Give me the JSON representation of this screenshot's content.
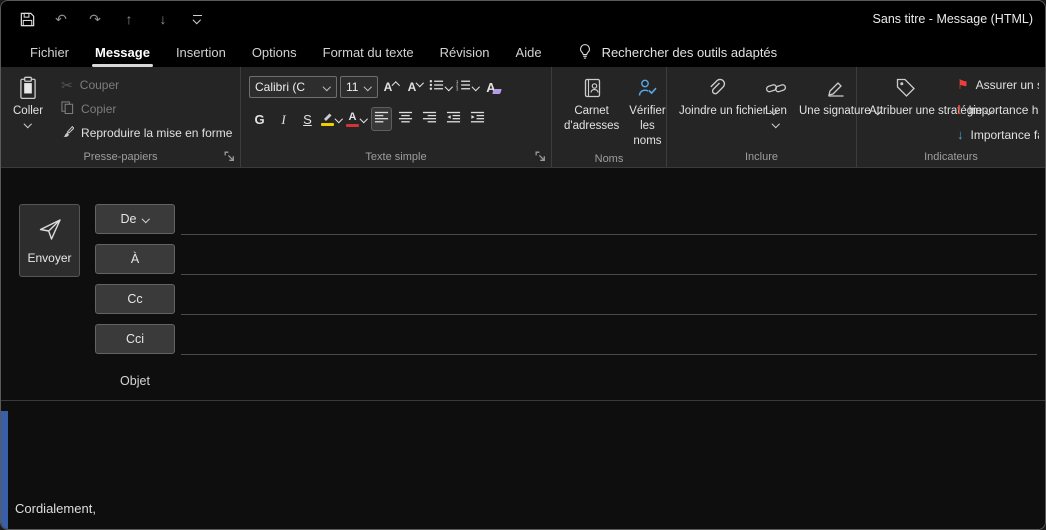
{
  "window": {
    "title": "Sans titre  -  Message (HTML)"
  },
  "icons": {
    "scissors": "✂",
    "undo": "↶",
    "redo": "↷",
    "up_arrow": "↑",
    "down_arrow": "↓",
    "flag": "⚑",
    "high_importance_mark": "!",
    "low_importance_arrow": "↓",
    "grow_font_letter": "A",
    "shrink_font_letter": "A",
    "font_color_letter": "A",
    "clear_format_letter": "A"
  },
  "tabs": {
    "items": [
      "Fichier",
      "Message",
      "Insertion",
      "Options",
      "Format du texte",
      "Révision",
      "Aide"
    ],
    "search_label": "Rechercher des outils adaptés"
  },
  "ribbon": {
    "clipboard": {
      "group_label": "Presse-papiers",
      "paste": "Coller",
      "cut": "Couper",
      "copy": "Copier",
      "format_painter": "Reproduire la mise en forme"
    },
    "text": {
      "group_label": "Texte simple",
      "font_name": "Calibri (C",
      "font_size": "11",
      "bold": "G",
      "italic": "I",
      "underline": "S"
    },
    "names": {
      "group_label": "Noms",
      "address_book": "Carnet d'adresses",
      "check_names": "Vérifier les noms"
    },
    "include": {
      "group_label": "Inclure",
      "attach_file": "Joindre un fichier",
      "link": "Lien",
      "signature": "Une signature"
    },
    "tags": {
      "group_label": "Indicateurs",
      "assign_policy": "Attribuer une stratégie",
      "follow_up": "Assurer un suivi",
      "high_importance": "Importance haut",
      "low_importance": "Importance faib"
    }
  },
  "compose": {
    "send": "Envoyer",
    "from": "De",
    "to": "À",
    "cc": "Cc",
    "bcc": "Cci",
    "subject_label": "Objet",
    "body_text": "Cordialement,"
  }
}
